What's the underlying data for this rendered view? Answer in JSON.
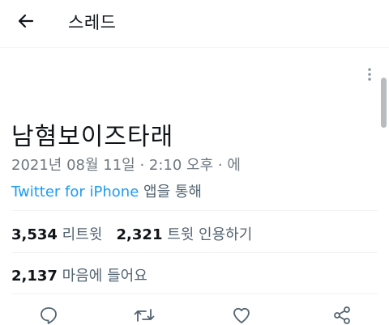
{
  "header": {
    "title": "스레드",
    "back_icon": "arrow-left-icon"
  },
  "tweet": {
    "text": "남혐보이즈타래",
    "timestamp": "2021년 08월 11일 · 2:10 오후 · 에",
    "source_link": "Twitter for iPhone",
    "source_suffix": " 앱을 통해"
  },
  "stats": {
    "retweets_count": "3,534",
    "retweets_label": "리트윗",
    "quotes_count": "2,321",
    "quotes_label": "트윗 인용하기",
    "likes_count": "2,137",
    "likes_label": "마음에 들어요"
  },
  "actions": [
    {
      "icon": "reply-icon"
    },
    {
      "icon": "retweet-icon"
    },
    {
      "icon": "like-icon"
    },
    {
      "icon": "share-icon"
    }
  ],
  "colors": {
    "link": "#1d9bf0",
    "secondary_text": "#536471",
    "divider": "#eff3f4"
  }
}
